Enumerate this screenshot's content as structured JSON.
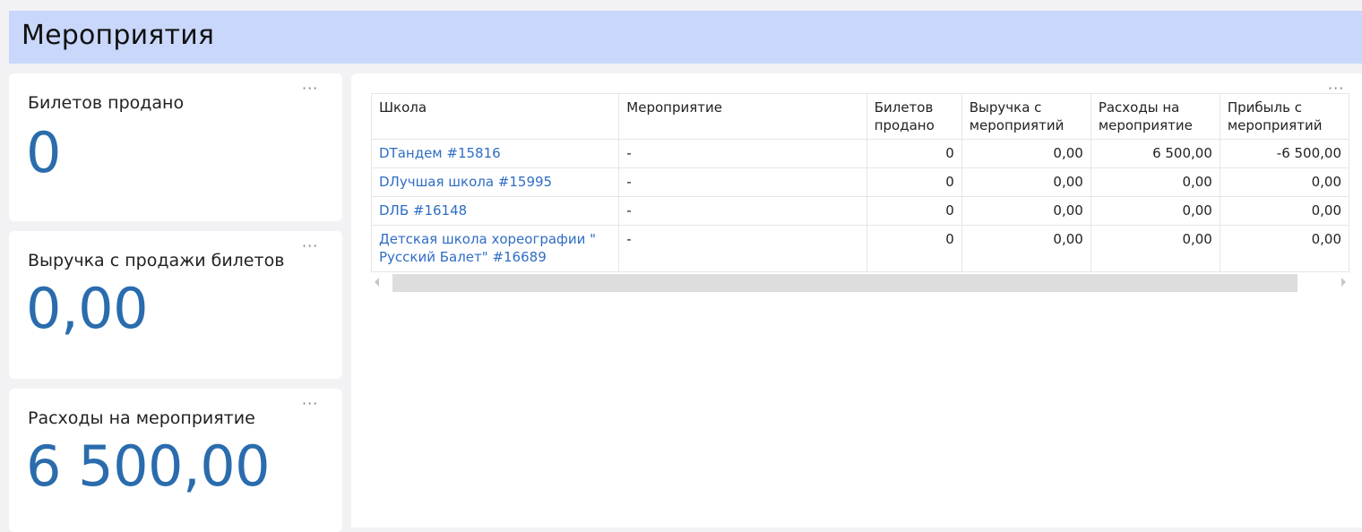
{
  "header": {
    "title": "Мероприятия",
    "accent_color": "#c9d7fb"
  },
  "kpis": [
    {
      "title": "Билетов продано",
      "value": "0"
    },
    {
      "title": "Выручка с продажи билетов",
      "value": "0,00"
    },
    {
      "title": "Расходы на мероприятие",
      "value": "6 500,00"
    }
  ],
  "widget_menu_glyph": "···",
  "table": {
    "columns": [
      "Школа",
      "Мероприятие",
      "Билетов продано",
      "Выручка с мероприятий",
      "Расходы на мероприятие",
      "Прибыль с мероприятий"
    ],
    "rows": [
      {
        "school": "DТандем #15816",
        "event": "-",
        "tickets": "0",
        "revenue": "0,00",
        "expenses": "6 500,00",
        "profit": "-6 500,00"
      },
      {
        "school": "DЛучшая школа #15995",
        "event": "-",
        "tickets": "0",
        "revenue": "0,00",
        "expenses": "0,00",
        "profit": "0,00"
      },
      {
        "school": "DЛБ #16148",
        "event": "-",
        "tickets": "0",
        "revenue": "0,00",
        "expenses": "0,00",
        "profit": "0,00"
      },
      {
        "school": "Детская школа хореографии \" Русский Балет\" #16689",
        "event": "-",
        "tickets": "0",
        "revenue": "0,00",
        "expenses": "0,00",
        "profit": "0,00"
      }
    ]
  }
}
